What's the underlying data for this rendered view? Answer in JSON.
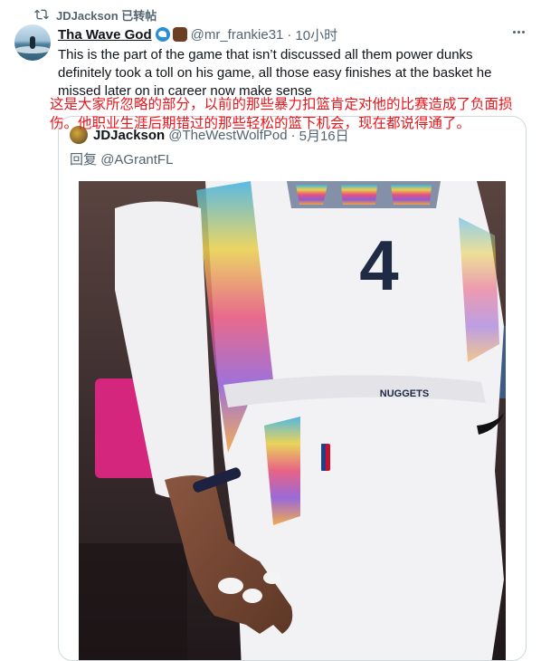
{
  "retweet": {
    "label": "JDJackson 已转帖"
  },
  "tweet": {
    "author_name": "Tha Wave God",
    "handle": "@mr_frankie31",
    "separator": "·",
    "time": "10小时",
    "text": "This is the part of the game that isn’t discussed all them power dunks definitely took a toll on his game, all those easy finishes at the basket he missed later on in career now make sense",
    "translation": "这是大家所忽略的部分，以前的那些暴力扣篮肯定对他的比赛造成了负面损伤。他职业生涯后期错过的那些轻松的篮下机会，现在都说得通了。"
  },
  "quote": {
    "author_name": "JDJackson",
    "handle": "@TheWestWolfPod",
    "separator": "·",
    "date": "5月16日",
    "reply_prefix": "回复",
    "reply_mention": "@AGrantFL"
  },
  "photo": {
    "jersey_number": "4",
    "waistband_text": "NUGGETS",
    "colors": {
      "jersey": "#f4f4f6",
      "skin": "#7a4a35",
      "background": "#2b2226",
      "accent_pink": "#d4267c"
    }
  },
  "icons": [
    "retweet-icon",
    "more-icon",
    "wave-emoji-icon",
    "fist-emoji-icon"
  ]
}
